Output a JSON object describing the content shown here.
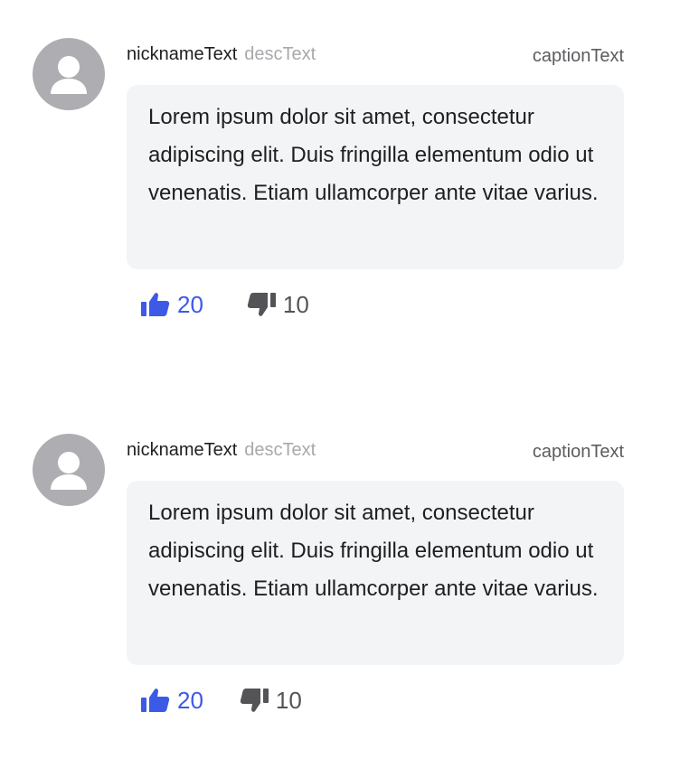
{
  "comments": [
    {
      "nickname": "nicknameText",
      "desc": "descText",
      "caption": "captionText",
      "body": "Lorem ipsum dolor sit amet, consectetur adipiscing elit. Duis fringilla elementum odio ut venenatis. Etiam ullamcorper ante vitae varius.",
      "likes": "20",
      "dislikes": "10"
    },
    {
      "nickname": "nicknameText",
      "desc": "descText",
      "caption": "captionText",
      "body": "Lorem ipsum dolor sit amet, consectetur adipiscing elit. Duis fringilla elementum odio ut venenatis. Etiam ullamcorper ante vitae varius.",
      "likes": "20",
      "dislikes": "10"
    }
  ],
  "icons": {
    "avatar": "user-avatar-icon",
    "like": "thumbs-up-icon",
    "dislike": "thumbs-down-icon"
  },
  "colors": {
    "like": "#3d5ae6",
    "dislike": "#545458",
    "bubble": "#f3f4f6",
    "avatar": "#aeaeb2",
    "desc": "#a9a9ad"
  }
}
